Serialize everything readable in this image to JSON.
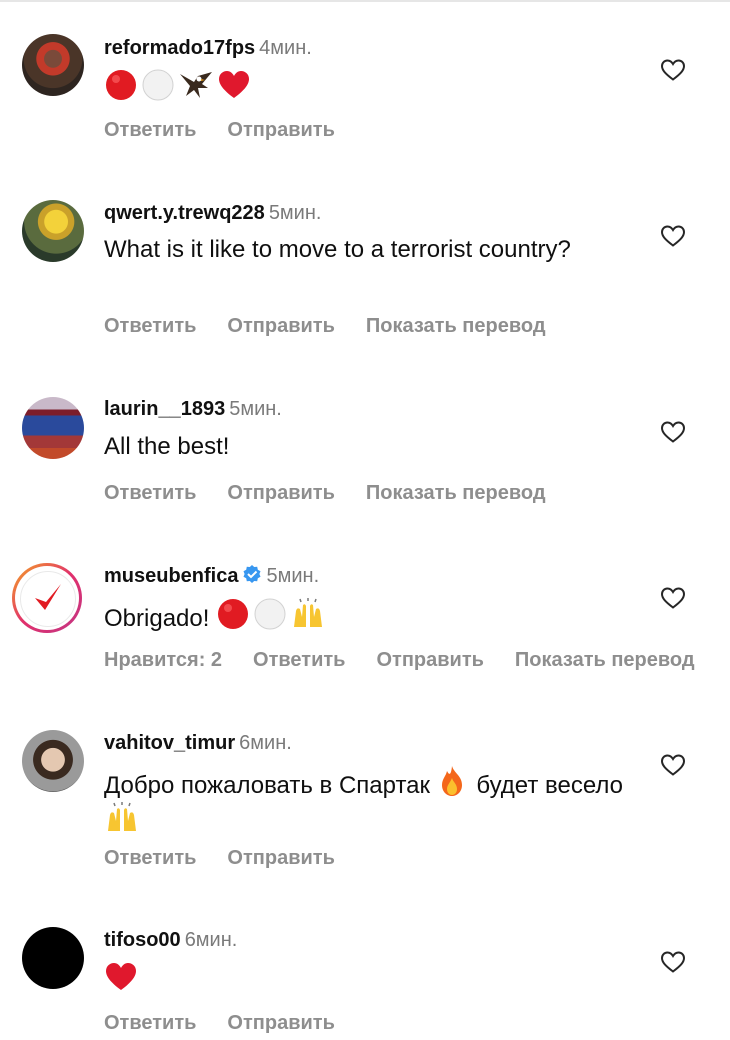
{
  "comments": [
    {
      "username": "reformado17fps",
      "time": "4мин.",
      "text": "",
      "emojis": [
        "red-circle",
        "white-circle",
        "eagle",
        "red-heart"
      ],
      "actions": [
        "Ответить",
        "Отправить"
      ],
      "avatar": "reformado-avatar"
    },
    {
      "username": "qwert.y.trewq228",
      "time": "5мин.",
      "text": "What is it like to move to a terrorist country?",
      "actions": [
        "Ответить",
        "Отправить",
        "Показать перевод"
      ],
      "avatar": "minion-avatar"
    },
    {
      "username": "laurin__1893",
      "time": "5мин.",
      "text": "All the best!",
      "actions": [
        "Ответить",
        "Отправить",
        "Показать перевод"
      ],
      "avatar": "team-photo-avatar"
    },
    {
      "username": "museubenfica",
      "verified": true,
      "time": "5мин.",
      "text": "Obrigado!",
      "emojis": [
        "red-circle",
        "white-circle",
        "raising-hands"
      ],
      "actions": [
        "Нравится: 2",
        "Ответить",
        "Отправить",
        "Показать перевод"
      ],
      "avatar": "checkmark-logo-avatar"
    },
    {
      "username": "vahitov_timur",
      "time": "6мин.",
      "text": "Добро пожаловать в Спартак",
      "text_tail": "будет весело",
      "emojis": [
        "fire",
        "raising-hands"
      ],
      "actions": [
        "Ответить",
        "Отправить"
      ],
      "avatar": "portrait-avatar"
    },
    {
      "username": "tifoso00",
      "time": "6мин.",
      "text": "",
      "emojis": [
        "red-heart"
      ],
      "actions": [
        "Ответить",
        "Отправить"
      ],
      "avatar": "black-avatar"
    }
  ],
  "colors": {
    "username": "#111111",
    "muted": "#8e8e8e",
    "verified": "#3897f0",
    "heart_emoji": "#e0182d",
    "benfica_red": "#e11b22"
  }
}
